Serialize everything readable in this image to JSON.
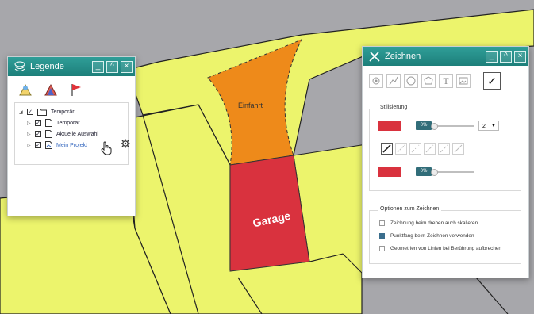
{
  "map": {
    "einfahrt_label": "Einfahrt",
    "garage_label": "Garage",
    "colors": {
      "background": "#a7a7ab",
      "parcel": "#ecf46c",
      "einfahrt": "#ee8a1a",
      "garage": "#d9323e"
    }
  },
  "legend": {
    "title": "Legende",
    "toolbar_icons": [
      "add-layer-icon",
      "layers-icon",
      "flag-icon"
    ],
    "tree": {
      "root": "Temporär",
      "children": [
        "Temporär",
        "Aktuelle Auswahl",
        "Mein Projekt"
      ]
    }
  },
  "zeichnen": {
    "title": "Zeichnen",
    "tools": [
      "point-icon",
      "line-icon",
      "circle-icon",
      "polygon-icon",
      "T",
      "image-icon"
    ],
    "confirm": "✓",
    "stilisierung": {
      "label": "Stilisierung",
      "fill_opacity": "0%",
      "line_width": "2",
      "stroke_opacity": "0%"
    },
    "options": {
      "label": "Optionen zum Zeichnen",
      "items": [
        {
          "label": "Zeichnung beim drehen auch skalieren",
          "checked": false
        },
        {
          "label": "Punktfang beim Zeichnen verwenden",
          "checked": true
        },
        {
          "label": "Geometrien von Linien bei Berührung aufbrechen",
          "checked": false
        }
      ]
    },
    "accent": "#1d7f7a"
  }
}
